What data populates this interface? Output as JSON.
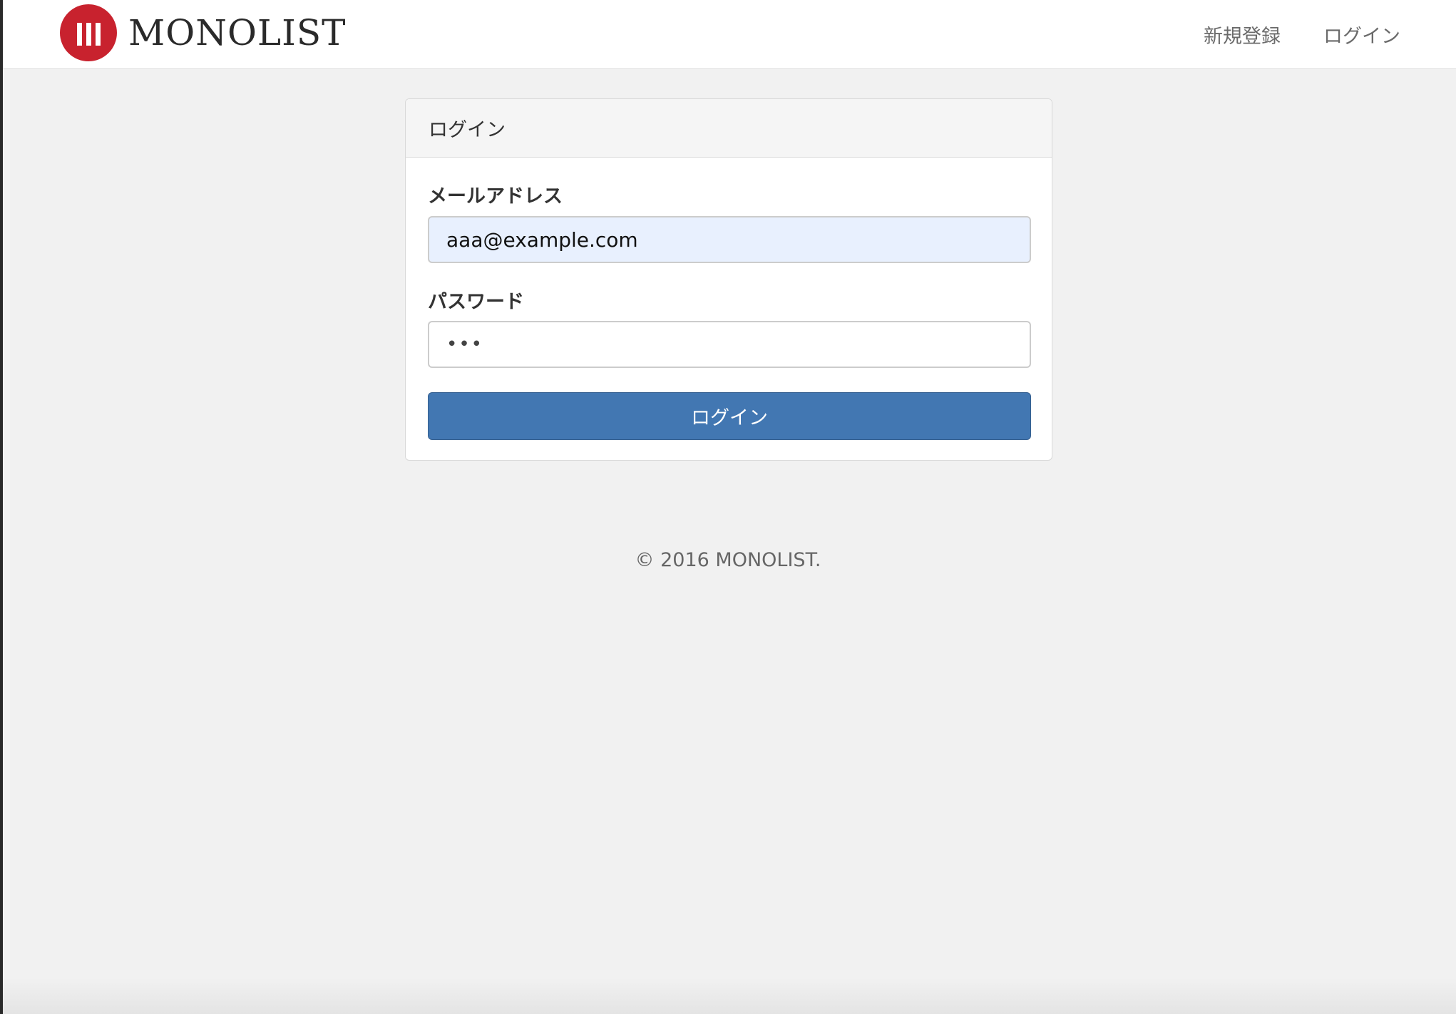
{
  "header": {
    "brand": "MONOLIST",
    "nav": {
      "signup": "新規登録",
      "login": "ログイン"
    }
  },
  "login_panel": {
    "title": "ログイン",
    "email_label": "メールアドレス",
    "email_value": "aaa@example.com",
    "password_label": "パスワード",
    "password_value": "•••",
    "submit_label": "ログイン"
  },
  "footer": {
    "copyright": "© 2016 MONOLIST."
  },
  "colors": {
    "brand_red": "#c8222e",
    "button_blue": "#4277b2",
    "autofill_bg": "#e8f0fe"
  }
}
